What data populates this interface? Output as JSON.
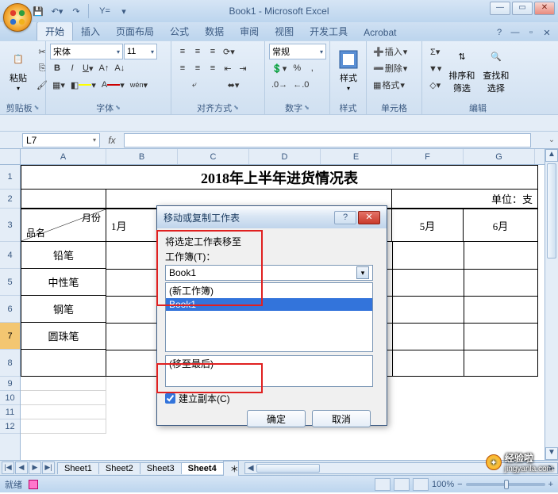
{
  "window": {
    "title": "Book1 - Microsoft Excel"
  },
  "qat": {
    "save": "💾",
    "undo": "↶",
    "redo": "↷",
    "ycmd": "Y="
  },
  "tabs": {
    "items": [
      "开始",
      "插入",
      "页面布局",
      "公式",
      "数据",
      "审阅",
      "视图",
      "开发工具",
      "Acrobat"
    ],
    "active": 0
  },
  "ribbon": {
    "clipboard": {
      "label": "剪贴板",
      "paste": "粘贴"
    },
    "font": {
      "label": "字体",
      "name": "宋体",
      "size": "11"
    },
    "align": {
      "label": "对齐方式"
    },
    "number": {
      "label": "数字",
      "format": "常规"
    },
    "styles": {
      "label": "样式"
    },
    "cells": {
      "label": "单元格",
      "insert": "插入",
      "delete": "删除",
      "format": "格式"
    },
    "editing": {
      "label": "编辑",
      "sort": "排序和\n筛选",
      "find": "查找和\n选择"
    }
  },
  "namebox": "L7",
  "sheet": {
    "cols": [
      "A",
      "B",
      "C",
      "D",
      "E",
      "F",
      "G"
    ],
    "rows": [
      "1",
      "2",
      "3",
      "4",
      "5",
      "6",
      "7",
      "8",
      "9",
      "10",
      "11",
      "12"
    ],
    "title": "2018年上半年进货情况表",
    "unit_label": "单位：支",
    "diag": {
      "top": "月份",
      "bottom": "品名"
    },
    "months": [
      "1月",
      "5月",
      "6月"
    ],
    "items": [
      "铅笔",
      "中性笔",
      "钢笔",
      "圆珠笔"
    ],
    "selected_row": 7
  },
  "sheet_tabs": {
    "items": [
      "Sheet1",
      "Sheet2",
      "Sheet3",
      "Sheet4"
    ],
    "active": 3
  },
  "status": {
    "ready": "就绪",
    "rec": "�square",
    "zoom": "100%"
  },
  "dialog": {
    "title": "移动或复制工作表",
    "label1": "将选定工作表移至",
    "label2": "工作簿(T)：",
    "workbook": "Book1",
    "list_items": [
      "(新工作簿)",
      "Book1"
    ],
    "list_selected": 1,
    "before_label": "(移至最后)",
    "copy_label": "建立副本(C)",
    "copy_checked": true,
    "ok": "确定",
    "cancel": "取消"
  },
  "watermark": {
    "brand": "经验啦",
    "url": "jingyanla.com"
  }
}
